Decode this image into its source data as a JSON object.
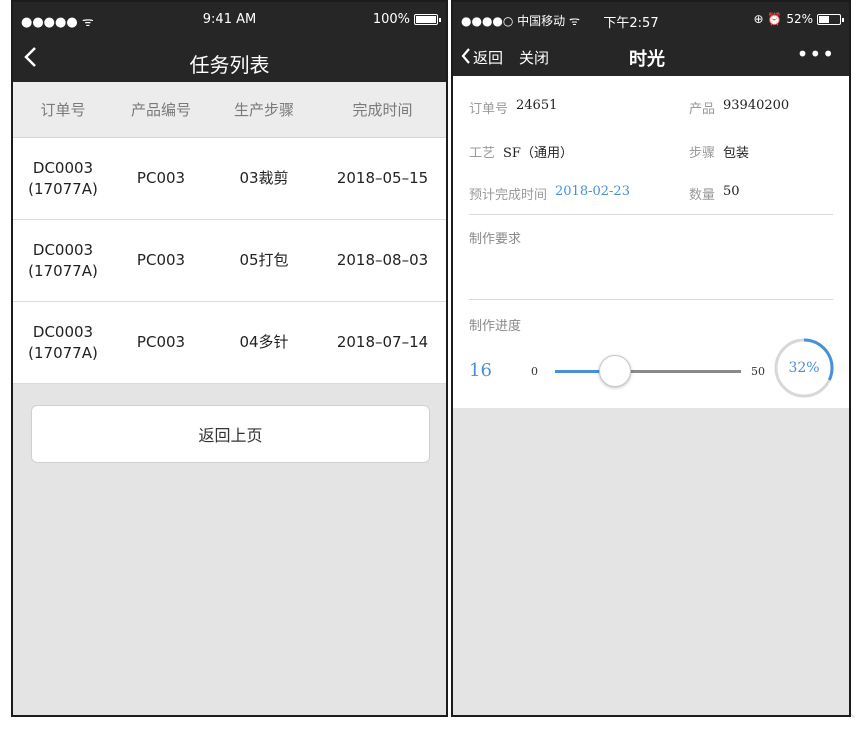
{
  "left_phone": {
    "status": {
      "carrier": "●●●●● ᯤ",
      "time": "9:41 AM",
      "battery": "100%",
      "battery_level": 1.0
    },
    "nav": {
      "back_icon": "chevron-left-icon",
      "title": "任务列表"
    },
    "table": {
      "headers": [
        "订单号",
        "产品编号",
        "生产步骤",
        "完成时间"
      ],
      "rows": [
        {
          "order": "DC0003",
          "order_sub": "(17077A)",
          "product": "PC003",
          "step": "03裁剪",
          "date": "2018–05–15"
        },
        {
          "order": "DC0003",
          "order_sub": "(17077A)",
          "product": "PC003",
          "step": "05打包",
          "date": "2018–08–03"
        },
        {
          "order": "DC0003",
          "order_sub": "(17077A)",
          "product": "PC003",
          "step": "04多针",
          "date": "2018–07–14"
        }
      ]
    },
    "back_button": "返回上页"
  },
  "right_phone": {
    "status": {
      "carrier": "●●●●○ 中国移动 ᯤ",
      "time": "下午2:57",
      "icons": "⊕ ⏰",
      "battery": "52%",
      "battery_level": 0.52
    },
    "nav": {
      "back_label": "返回",
      "close_label": "关闭",
      "title": "时光",
      "more": "•••"
    },
    "details": {
      "order_label": "订单号",
      "order_value": "24651",
      "product_label": "产品",
      "product_value": "93940200",
      "process_label": "工艺",
      "process_value": "SF（通用）",
      "step_label": "步骤",
      "step_value": "包装",
      "due_label": "预计完成时间",
      "due_value": "2018-02-23",
      "qty_label": "数量",
      "qty_value": "50"
    },
    "requirements_label": "制作要求",
    "progress": {
      "label": "制作进度",
      "value": "16",
      "min": "0",
      "max": "50",
      "percent_text": "32%",
      "fraction": 0.32
    }
  },
  "colors": {
    "accent": "#4a90d9",
    "bar": "#262626",
    "background": "#e4e4e4"
  },
  "corner_mark": "⸜"
}
